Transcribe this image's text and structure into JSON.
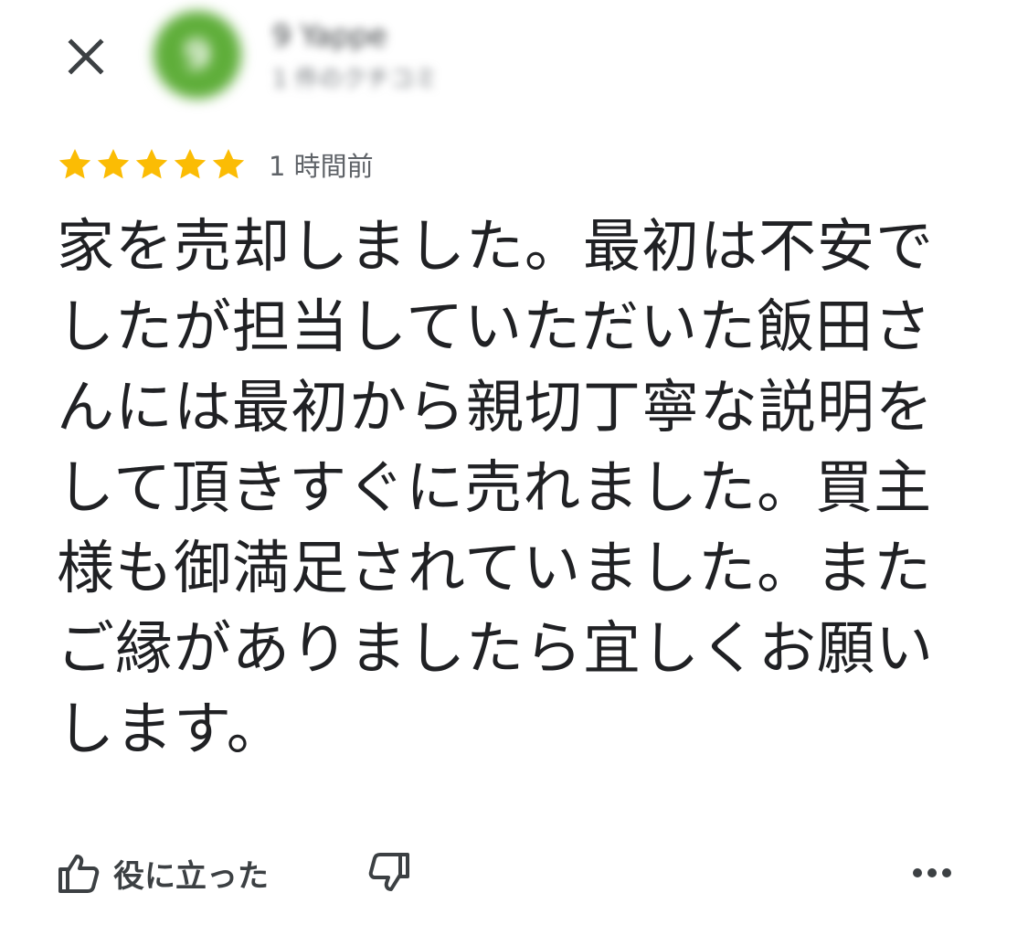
{
  "header": {
    "close_icon": "close-icon",
    "avatar_letter": "9",
    "avatar_color": "#5fae3a",
    "author_name": "9 Yappe",
    "author_meta": "1 件のクチコミ"
  },
  "review": {
    "rating": 5,
    "max_rating": 5,
    "star_color": "#fbbc04",
    "time": "1 時間前",
    "text": "家を売却しました。最初は不安でしたが担当していただいた飯田さんには最初から親切丁寧な説明をして頂きすぐに売れました。買主様も御満足されていました。またご縁がありましたら宜しくお願いします。"
  },
  "actions": {
    "helpful_label": "役に立った",
    "helpful_icon": "thumbs-up-icon",
    "dislike_icon": "thumbs-down-icon",
    "more_icon": "more-horizontal-icon"
  }
}
